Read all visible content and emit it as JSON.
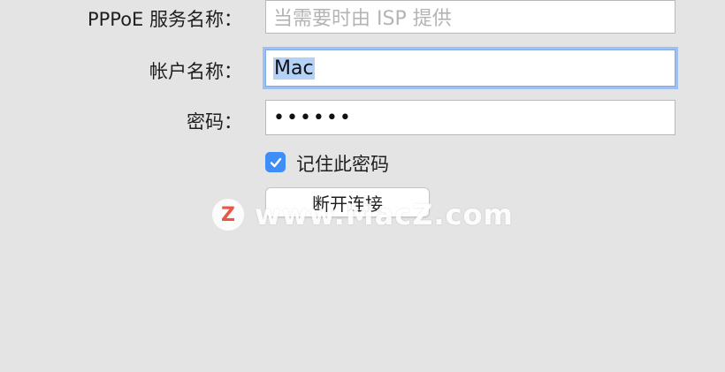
{
  "form": {
    "service_label": "PPPoE 服务名称：",
    "service_placeholder": "当需要时由 ISP 提供",
    "account_label": "帐户名称：",
    "account_value": "Mac",
    "password_label": "密码：",
    "password_value": "••••••",
    "remember_label": "记住此密码",
    "remember_checked": true,
    "disconnect_label": "断开连接"
  },
  "watermark": {
    "logo_letter": "Z",
    "text": "www.MacZ.com"
  },
  "colors": {
    "accent": "#3e8ef7",
    "background": "#e4e4e4"
  }
}
